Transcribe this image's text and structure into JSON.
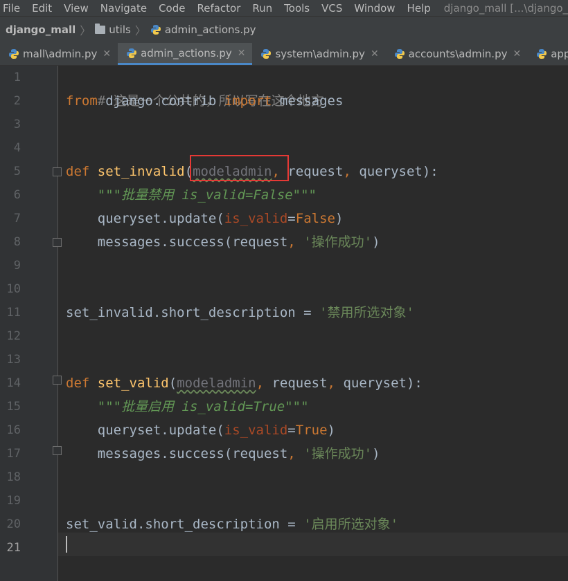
{
  "menu": {
    "items": [
      "File",
      "Edit",
      "View",
      "Navigate",
      "Code",
      "Refactor",
      "Run",
      "Tools",
      "VCS",
      "Window",
      "Help"
    ],
    "window_title": "django_mall [...\\django_m"
  },
  "breadcrumb": {
    "project": "django_mall",
    "folder": "utils",
    "file": "admin_actions.py"
  },
  "tabs": [
    {
      "label": "mall\\admin.py",
      "active": false
    },
    {
      "label": "admin_actions.py",
      "active": true
    },
    {
      "label": "system\\admin.py",
      "active": false
    },
    {
      "label": "accounts\\admin.py",
      "active": false
    },
    {
      "label": "apps.py",
      "active": false
    }
  ],
  "editor": {
    "line_numbers": [
      "1",
      "2",
      "3",
      "4",
      "5",
      "6",
      "7",
      "8",
      "9",
      "10",
      "11",
      "12",
      "13",
      "14",
      "15",
      "16",
      "17",
      "18",
      "19",
      "20",
      "21"
    ],
    "current_line": "21",
    "code": {
      "l1": "# 这是一个公共的，所以写在这个地方",
      "l2_kw1": "from",
      "l2_mod": " django.contrib ",
      "l2_kw2": "import",
      "l2_name": " messages",
      "l5_def": "def",
      "l5_sp": " ",
      "l5_fn": "set_invalid",
      "l5_open": "(",
      "l5_p1": "modeladmin",
      "l5_c1": ",",
      "l5_rest": " request",
      "l5_c2": ",",
      "l5_rest2": " queryset):",
      "l6": "    \"\"\"批量禁用 is_valid=False\"\"\"",
      "l7_a": "    queryset.update(",
      "l7_kw": "is_valid",
      "l7_eq": "=",
      "l7_val": "False",
      "l7_close": ")",
      "l8_a": "    messages.success(request",
      "l8_c": ",",
      "l8_sp": " ",
      "l8_str": "'操作成功'",
      "l8_close": ")",
      "l11_a": "set_invalid.short_description = ",
      "l11_str": "'禁用所选对象'",
      "l14_def": "def",
      "l14_sp": " ",
      "l14_fn": "set_valid",
      "l14_open": "(",
      "l14_p1": "modeladmin",
      "l14_c1": ",",
      "l14_rest": " request",
      "l14_c2": ",",
      "l14_rest2": " queryset):",
      "l15": "    \"\"\"批量启用 is_valid=True\"\"\"",
      "l16_a": "    queryset.update(",
      "l16_kw": "is_valid",
      "l16_eq": "=",
      "l16_val": "True",
      "l16_close": ")",
      "l17_a": "    messages.success(request",
      "l17_c": ",",
      "l17_sp": " ",
      "l17_str": "'操作成功'",
      "l17_close": ")",
      "l20_a": "set_valid.short_description = ",
      "l20_str": "'启用所选对象'"
    }
  },
  "colors": {
    "background": "#2b2b2b",
    "keyword": "#cc7832",
    "function": "#ffc66d",
    "string": "#6a8759",
    "comment": "#808080",
    "highlight_box": "#e53935"
  }
}
